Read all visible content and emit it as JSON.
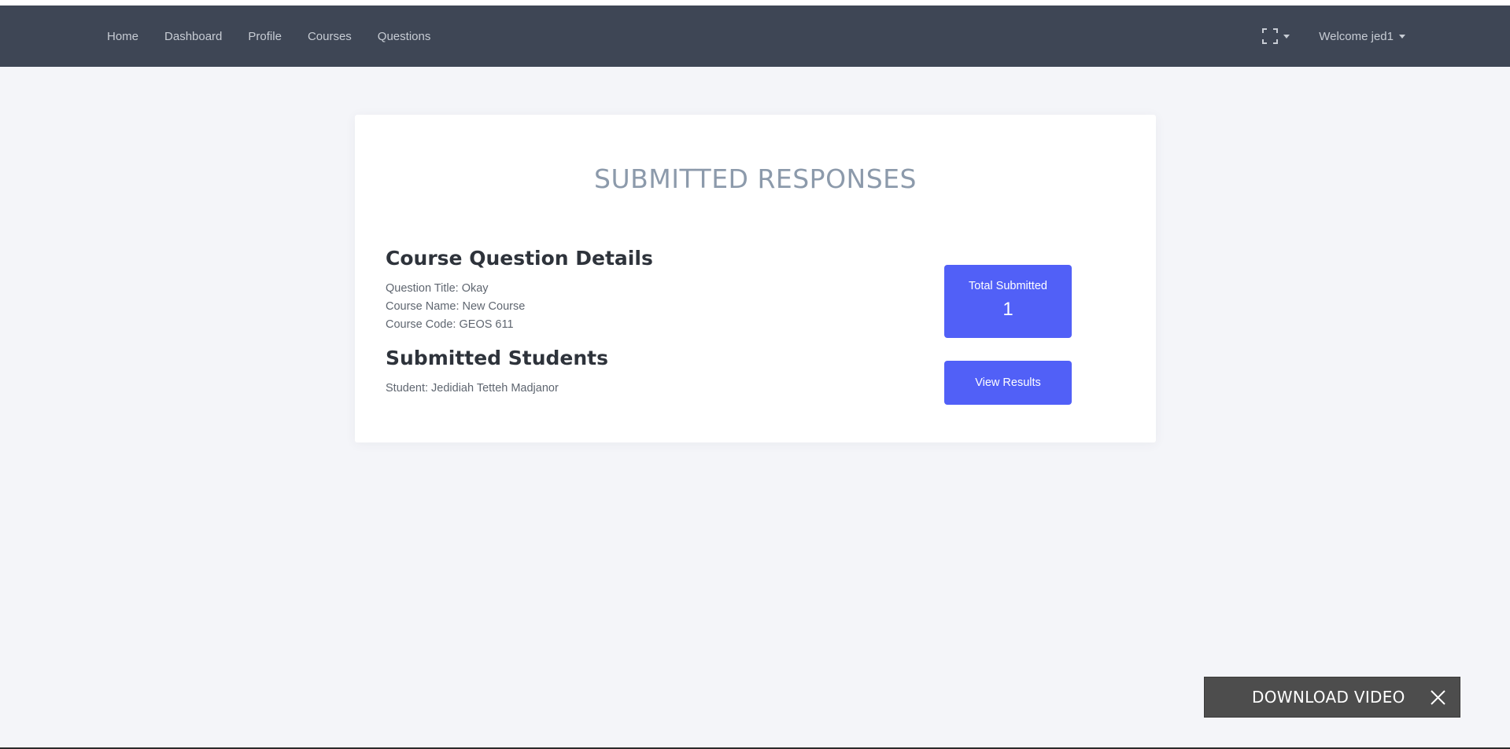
{
  "nav": {
    "links": [
      "Home",
      "Dashboard",
      "Profile",
      "Courses",
      "Questions"
    ],
    "fullscreen_icon": "fullscreen-icon",
    "welcome": "Welcome jed1"
  },
  "page": {
    "title": "SUBMITTED RESPONSES",
    "details_heading": "Course Question Details",
    "question_title": "Question Title: Okay",
    "course_name": "Course Name: New Course",
    "course_code": "Course Code: GEOS 611",
    "students_heading": "Submitted Students",
    "student": "Student: Jedidiah Tetteh Madjanor",
    "total_label": "Total Submitted",
    "total_value": "1",
    "view_results": "View Results"
  },
  "download": {
    "label": "DOWNLOAD VIDEO",
    "close_icon": "close-icon"
  },
  "colors": {
    "navbar": "#3e4655",
    "accent": "#5160f7",
    "background": "#f4f5f9"
  }
}
